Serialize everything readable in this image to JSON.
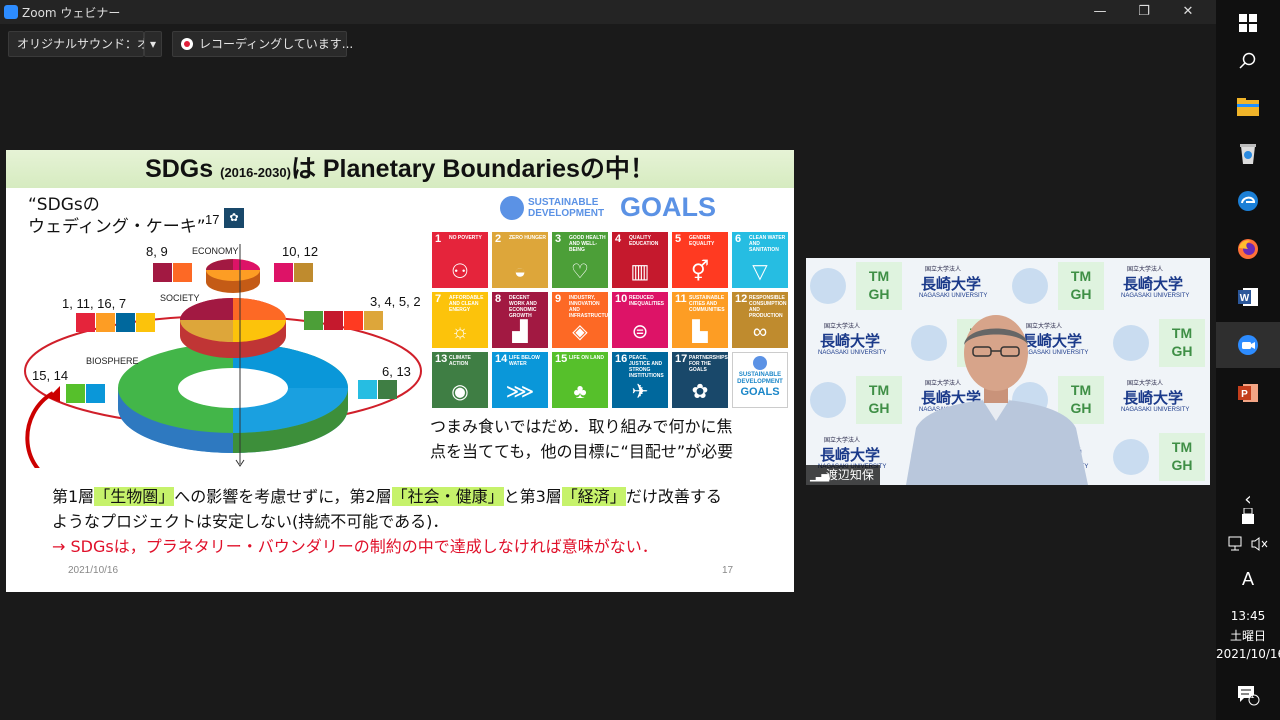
{
  "window": {
    "title": "Zoom ウェビナー",
    "minimize": "—",
    "restore": "❐",
    "close": "✕"
  },
  "toolbar": {
    "sound_label": "オリジナルサウンド：オフ",
    "sound_caret": "▾",
    "recording_label": "レコーディングしています..."
  },
  "slide": {
    "title_main": "SDGs",
    "title_years": "(2016-2030)",
    "title_rest": "は Planetary Boundariesの中！",
    "cake_caption_1": "“SDGsの",
    "cake_caption_2": "ウェディング・ケーキ”",
    "goal17_label": "17",
    "economy_label": "ECONOMY",
    "society_label": "SOCIETY",
    "biosphere_label": "BIOSPHERE",
    "economy_left": "8, 9",
    "economy_right": "10, 12",
    "society_left": "1, 11, 16, 7",
    "society_right": "3, 4, 5, 2",
    "bio_left": "15, 14",
    "bio_right": "6, 13",
    "logo_line1": "SUSTAINABLE",
    "logo_line2": "DEVELOPMENT",
    "logo_goals": "GOALS",
    "note_line1": "つまみ食いではだめ．取り組みで何かに焦",
    "note_line2": "点を当てても，他の目標に“目配せ”が必要",
    "body_1a": "第1層",
    "body_1b": "「生物圏」",
    "body_1c": "への影響を考慮せずに，第2層",
    "body_1d": "「社会・健康」",
    "body_1e": "と第3層",
    "body_1f": "「経済」",
    "body_1g": "だけ改善する",
    "body_2": "ようなプロジェクトは安定しない(持続不可能である)．",
    "body_3": "→ SDGsは，プラネタリー・バウンダリーの制約の中で達成しなければ意味がない．",
    "footer_date": "2021/10/16",
    "page_number": "17"
  },
  "sdgs": [
    {
      "n": "1",
      "t": "NO POVERTY",
      "c": "#e5243b",
      "g": "⚇"
    },
    {
      "n": "2",
      "t": "ZERO HUNGER",
      "c": "#dda63a",
      "g": "◒"
    },
    {
      "n": "3",
      "t": "GOOD HEALTH AND WELL-BEING",
      "c": "#4c9f38",
      "g": "♡"
    },
    {
      "n": "4",
      "t": "QUALITY EDUCATION",
      "c": "#c5192d",
      "g": "▥"
    },
    {
      "n": "5",
      "t": "GENDER EQUALITY",
      "c": "#ff3a21",
      "g": "⚥"
    },
    {
      "n": "6",
      "t": "CLEAN WATER AND SANITATION",
      "c": "#26bde2",
      "g": "▽"
    },
    {
      "n": "7",
      "t": "AFFORDABLE AND CLEAN ENERGY",
      "c": "#fcc30b",
      "g": "☼"
    },
    {
      "n": "8",
      "t": "DECENT WORK AND ECONOMIC GROWTH",
      "c": "#a21942",
      "g": "▟"
    },
    {
      "n": "9",
      "t": "INDUSTRY, INNOVATION AND INFRASTRUCTURE",
      "c": "#fd6925",
      "g": "◈"
    },
    {
      "n": "10",
      "t": "REDUCED INEQUALITIES",
      "c": "#dd1367",
      "g": "⊜"
    },
    {
      "n": "11",
      "t": "SUSTAINABLE CITIES AND COMMUNITIES",
      "c": "#fd9d24",
      "g": "▙"
    },
    {
      "n": "12",
      "t": "RESPONSIBLE CONSUMPTION AND PRODUCTION",
      "c": "#bf8b2e",
      "g": "∞"
    },
    {
      "n": "13",
      "t": "CLIMATE ACTION",
      "c": "#3f7e44",
      "g": "◉"
    },
    {
      "n": "14",
      "t": "LIFE BELOW WATER",
      "c": "#0a97d9",
      "g": "⋙"
    },
    {
      "n": "15",
      "t": "LIFE ON LAND",
      "c": "#56c02b",
      "g": "♣"
    },
    {
      "n": "16",
      "t": "PEACE, JUSTICE AND STRONG INSTITUTIONS",
      "c": "#00689d",
      "g": "✈"
    },
    {
      "n": "17",
      "t": "PARTNERSHIPS FOR THE GOALS",
      "c": "#19486a",
      "g": "✿"
    }
  ],
  "sdg_logo_tile": {
    "line1": "SUSTAINABLE",
    "line2": "DEVELOPMENT",
    "line3": "GOALS"
  },
  "video": {
    "participant_name": "渡辺知保",
    "wm_univ": "長崎大学",
    "wm_univ_en": "NAGASAKI UNIVERSITY",
    "wm_org": "国立大学法人",
    "wm_tmgh_1": "TM",
    "wm_tmgh_2": "GH"
  },
  "taskbar": {
    "time": "13:45",
    "weekday": "土曜日",
    "date": "2021/10/16",
    "ime": "A",
    "notifications": "1",
    "chevron": "‹"
  }
}
